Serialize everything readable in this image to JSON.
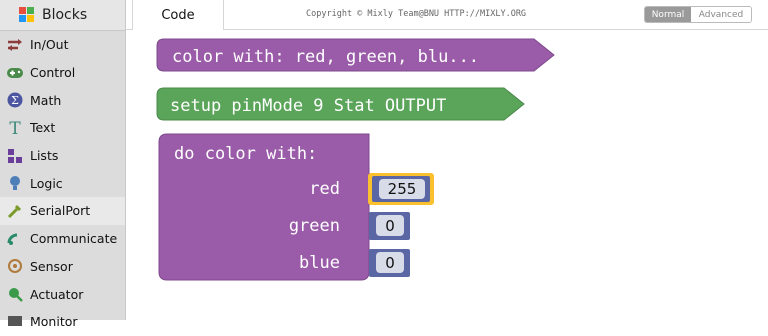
{
  "sidebar": {
    "header": "Blocks",
    "items": [
      {
        "label": "In/Out",
        "icon": "in-out-icon"
      },
      {
        "label": "Control",
        "icon": "gamepad-icon"
      },
      {
        "label": "Math",
        "icon": "math-icon"
      },
      {
        "label": "Text",
        "icon": "text-icon"
      },
      {
        "label": "Lists",
        "icon": "lists-icon"
      },
      {
        "label": "Logic",
        "icon": "bulb-icon"
      },
      {
        "label": "SerialPort",
        "icon": "serial-port-icon"
      },
      {
        "label": "Communicate",
        "icon": "satellite-icon"
      },
      {
        "label": "Sensor",
        "icon": "sensor-icon"
      },
      {
        "label": "Actuator",
        "icon": "actuator-icon"
      },
      {
        "label": "Monitor",
        "icon": "monitor-icon"
      }
    ]
  },
  "topbar": {
    "tab": "Code",
    "copyright": "Copyright © Mixly Team@BNU HTTP://MIXLY.ORG",
    "mode_normal": "Normal",
    "mode_advanced": "Advanced"
  },
  "blocks": {
    "color_block": "color with: red, green, blu...",
    "setup_block": "setup pinMode 9 Stat OUTPUT",
    "do_color_title": "do  color  with:",
    "red_label": "red",
    "green_label": "green",
    "blue_label": "blue",
    "red_value": "255",
    "green_value": "0",
    "blue_value": "0"
  },
  "colors": {
    "purple_block": "#9a5ba8",
    "green_block": "#5ba55b",
    "number_block": "#5b67a5",
    "highlight": "#fbc02d",
    "sidebar_bg": "#dcdcdc"
  }
}
